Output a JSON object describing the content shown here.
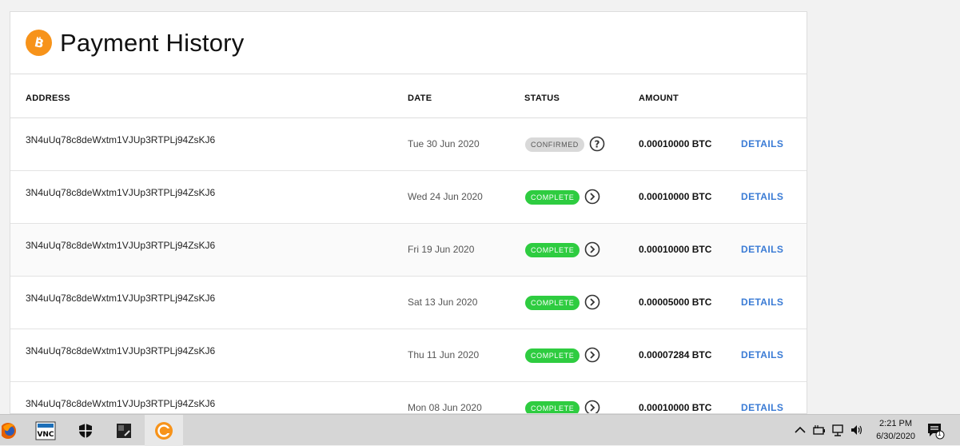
{
  "page": {
    "title": "Payment History"
  },
  "columns": {
    "address": "ADDRESS",
    "date": "DATE",
    "status": "STATUS",
    "amount": "AMOUNT"
  },
  "rows": [
    {
      "address": "3N4uUq78c8deWxtm1VJUp3RTPLj94ZsKJ6",
      "date": "Tue 30 Jun 2020",
      "status": "CONFIRMED",
      "status_kind": "confirmed",
      "status_icon": "question-circle-icon",
      "amount": "0.00010000 BTC",
      "action": "DETAILS"
    },
    {
      "address": "3N4uUq78c8deWxtm1VJUp3RTPLj94ZsKJ6",
      "date": "Wed 24 Jun 2020",
      "status": "COMPLETE",
      "status_kind": "complete",
      "status_icon": "chevron-right-circle-icon",
      "amount": "0.00010000 BTC",
      "action": "DETAILS"
    },
    {
      "address": "3N4uUq78c8deWxtm1VJUp3RTPLj94ZsKJ6",
      "date": "Fri 19 Jun 2020",
      "status": "COMPLETE",
      "status_kind": "complete",
      "status_icon": "chevron-right-circle-icon",
      "amount": "0.00010000 BTC",
      "action": "DETAILS"
    },
    {
      "address": "3N4uUq78c8deWxtm1VJUp3RTPLj94ZsKJ6",
      "date": "Sat 13 Jun 2020",
      "status": "COMPLETE",
      "status_kind": "complete",
      "status_icon": "chevron-right-circle-icon",
      "amount": "0.00005000 BTC",
      "action": "DETAILS"
    },
    {
      "address": "3N4uUq78c8deWxtm1VJUp3RTPLj94ZsKJ6",
      "date": "Thu 11 Jun 2020",
      "status": "COMPLETE",
      "status_kind": "complete",
      "status_icon": "chevron-right-circle-icon",
      "amount": "0.00007284 BTC",
      "action": "DETAILS"
    },
    {
      "address": "3N4uUq78c8deWxtm1VJUp3RTPLj94ZsKJ6",
      "date": "Mon 08 Jun 2020",
      "status": "COMPLETE",
      "status_kind": "complete",
      "status_icon": "chevron-right-circle-icon",
      "amount": "0.00010000 BTC",
      "action": "DETAILS"
    }
  ],
  "colors": {
    "bitcoin": "#f7931a",
    "complete": "#2ecc40",
    "confirmed": "#d9d9d9",
    "link": "#3a7bd5"
  },
  "taskbar": {
    "apps": [
      "firefox-icon",
      "vnc-viewer-icon",
      "security-shield-icon",
      "terminal-icon",
      "coin-app-icon"
    ],
    "clock": {
      "time": "2:21 PM",
      "date": "6/30/2020"
    },
    "notification_count": "1"
  }
}
